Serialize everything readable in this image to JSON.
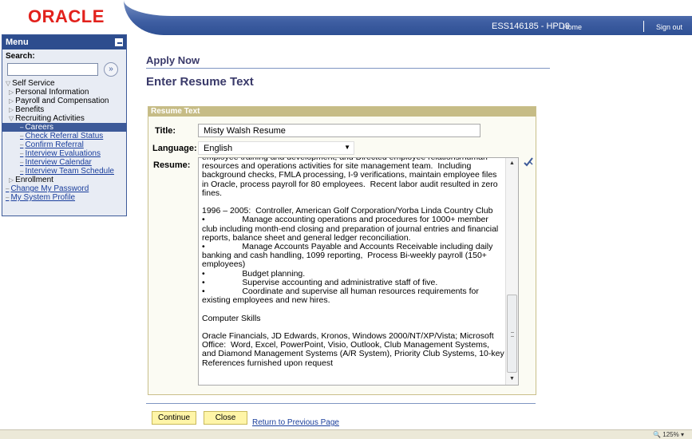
{
  "brand": {
    "logo_text": "ORACLE",
    "logo_color": "#e2211c",
    "accent_color": "#3d5a99"
  },
  "header": {
    "server": "ESS146185 - HPD9",
    "home_link": "Home",
    "signout_link": "Sign out"
  },
  "menu": {
    "title": "Menu",
    "search_label": "Search:",
    "search_value": "",
    "search_go_glyph": "»",
    "items": [
      {
        "label": "Self Service",
        "marker": "▽"
      },
      {
        "label": "Personal Information",
        "marker": "▷"
      },
      {
        "label": "Payroll and Compensation",
        "marker": "▷"
      },
      {
        "label": "Benefits",
        "marker": "▷"
      },
      {
        "label": "Recruiting Activities",
        "marker": "▽"
      },
      {
        "label": "Careers",
        "marker": "–"
      },
      {
        "label": "Check Referral Status",
        "marker": "–"
      },
      {
        "label": "Confirm Referral",
        "marker": "–"
      },
      {
        "label": "Interview Evaluations",
        "marker": "–"
      },
      {
        "label": "Interview Calendar",
        "marker": "–"
      },
      {
        "label": "Interview Team Schedule",
        "marker": "–"
      },
      {
        "label": "Enrollment",
        "marker": "▷"
      },
      {
        "label": "Change My Password",
        "marker": "–"
      },
      {
        "label": "My System Profile",
        "marker": "–"
      }
    ]
  },
  "page": {
    "breadcrumb": "Apply Now",
    "title": "Enter Resume Text"
  },
  "form": {
    "section_title": "Resume Text",
    "title_label": "Title:",
    "title_value": "Misty Walsh Resume",
    "language_label": "Language:",
    "language_value": "English",
    "resume_label": "Resume:",
    "resume_text": "employee training and development, and Directed employee relations/human resources and operations activities for site management team.  Including background checks, FMLA processing, I-9 verifications, maintain employee files in Oracle, process payroll for 80 employees.  Recent labor audit resulted in zero fines.\n\n1996 – 2005:  Controller, American Golf Corporation/Yorba Linda Country Club\n•                Manage accounting operations and procedures for 1000+ member club including month-end closing and preparation of journal entries and financial reports, balance sheet and general ledger reconciliation.\n•                Manage Accounts Payable and Accounts Receivable including daily banking and cash handling, 1099 reporting,  Process Bi-weekly payroll (150+ employees)\n•                Budget planning.\n•                Supervise accounting and administrative staff of five.\n•                Coordinate and supervise all human resources requirements for existing employees and new hires.\n\nComputer Skills\n\nOracle Financials, JD Edwards, Kronos, Windows 2000/NT/XP/Vista; Microsoft Office:  Word, Excel, PowerPoint, Visio, Outlook, Club Management Systems, and Diamond Management Systems (A/R System), Priority Club Systems, 10-key References furnished upon request"
  },
  "actions": {
    "continue": "Continue",
    "close": "Close",
    "return_link": "Return to Previous Page"
  },
  "status": {
    "zoom": "125%"
  }
}
